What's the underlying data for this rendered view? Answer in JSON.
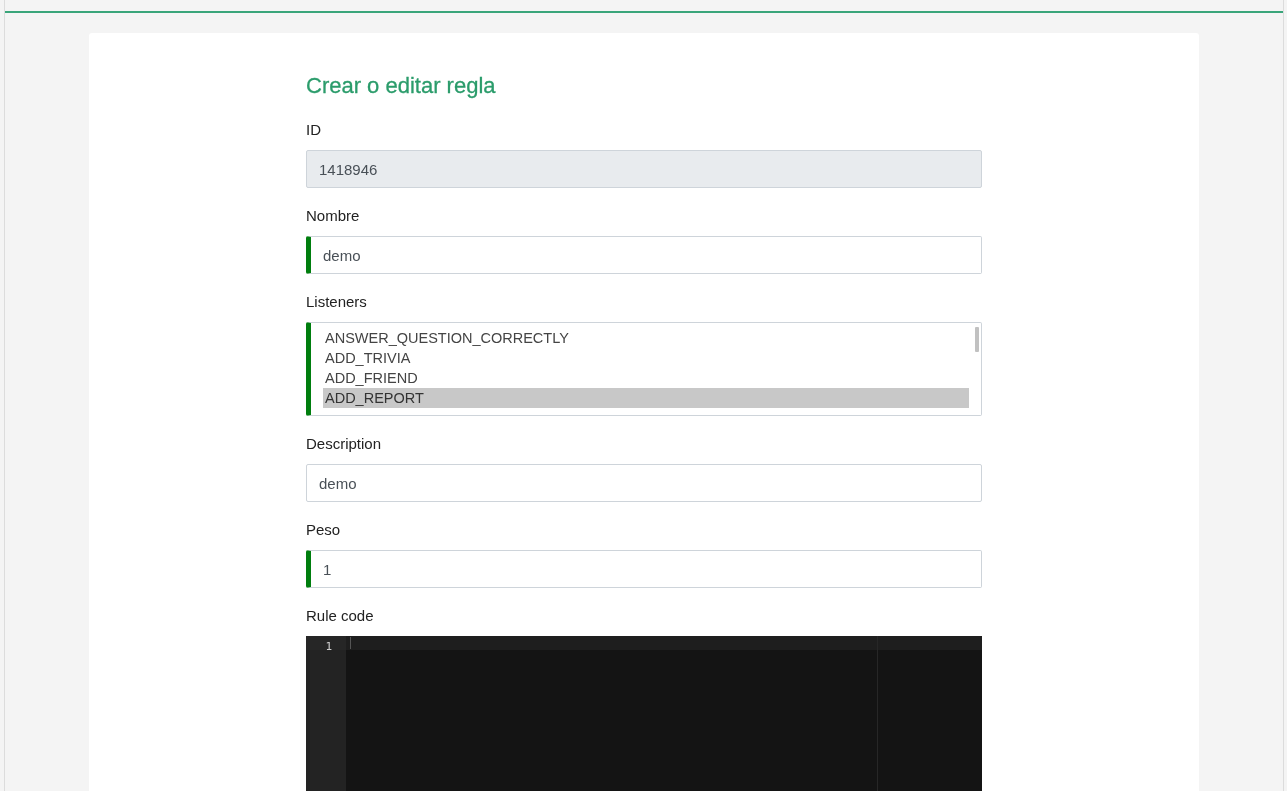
{
  "page": {
    "title": "Crear o editar regla"
  },
  "form": {
    "fields": [
      {
        "kind": "text",
        "label": "ID",
        "value": "1418946",
        "disabled": true,
        "valid": false
      },
      {
        "kind": "text",
        "label": "Nombre",
        "value": "demo",
        "disabled": false,
        "valid": true
      },
      {
        "kind": "listbox",
        "label": "Listeners",
        "disabled": false,
        "valid": true,
        "options": [
          {
            "label": "ANSWER_QUESTION_CORRECTLY",
            "selected": false
          },
          {
            "label": "ADD_TRIVIA",
            "selected": false
          },
          {
            "label": "ADD_FRIEND",
            "selected": false
          },
          {
            "label": "ADD_REPORT",
            "selected": true
          }
        ]
      },
      {
        "kind": "text",
        "label": "Description",
        "value": "demo",
        "disabled": false,
        "valid": false
      },
      {
        "kind": "text",
        "label": "Peso",
        "value": "1",
        "disabled": false,
        "valid": true
      },
      {
        "kind": "code",
        "label": "Rule code",
        "disabled": false,
        "valid": false,
        "line_numbers": [
          "1"
        ]
      }
    ]
  }
}
